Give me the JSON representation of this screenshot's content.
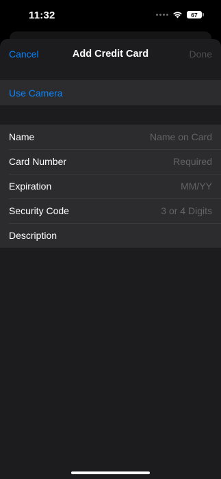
{
  "status_bar": {
    "time": "11:32",
    "battery_percent": "67"
  },
  "nav": {
    "cancel_label": "Cancel",
    "title": "Add Credit Card",
    "done_label": "Done"
  },
  "camera": {
    "label": "Use Camera"
  },
  "form": {
    "rows": [
      {
        "label": "Name",
        "placeholder": "Name on Card",
        "value": ""
      },
      {
        "label": "Card Number",
        "placeholder": "Required",
        "value": ""
      },
      {
        "label": "Expiration",
        "placeholder": "MM/YY",
        "value": ""
      },
      {
        "label": "Security Code",
        "placeholder": "3 or 4 Digits",
        "value": ""
      },
      {
        "label": "Description",
        "placeholder": "",
        "value": ""
      }
    ]
  },
  "colors": {
    "accent": "#0a84ff",
    "sheet_background": "#1c1c1e",
    "row_background": "#2c2c2e",
    "disabled_text": "#4d4d50",
    "placeholder_text": "#636366"
  },
  "icons": [
    "signal-dots-icon",
    "wifi-icon",
    "battery-icon"
  ]
}
